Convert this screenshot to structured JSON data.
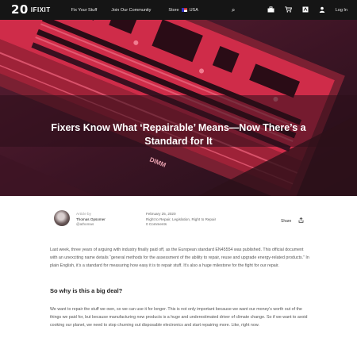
{
  "nav": {
    "logo_number": "20",
    "logo_word": "IFIXIT",
    "links": [
      "Fix Your Stuff",
      "Join Our Community"
    ],
    "store_label": "Store",
    "store_region": "USA",
    "login_label": "Log In",
    "icons": [
      "search-icon",
      "toolbox-icon",
      "cart-icon",
      "language-icon",
      "user-icon"
    ]
  },
  "hero": {
    "title": "Fixers Know What ‘Repairable’ Means—Now There’s a Standard for It",
    "board_label": "DIMM"
  },
  "article": {
    "author_prefix": "Article by",
    "author_name": "Thomas Opsomer",
    "author_handle": "@athomas",
    "date": "February 25, 2020",
    "tags": "Right to Repair, Legislation, Right to Repair",
    "comments": "0 Comments",
    "share_label": "Share",
    "paragraph1": "Last week, three years of arguing with industry finally paid off, as the European standard EN45554 was published. This official document with an unexciting name details “general methods for the assessment of the ability to repair, reuse and upgrade energy-related products.” In plain English, it’s a standard for measuring how easy it is to repair stuff. It’s also a huge milestone for the fight for our repair.",
    "heading": "So why is this a big deal?",
    "paragraph2": "We want to repair the stuff we own, so we can use it for longer. This is not only important because we want our money’s worth out of the things we paid for, but because manufacturing new products is a huge and underestimated driver of climate change. So if we want to avoid cooking our planet, we need to stop churning out disposable electronics and start repairing more. Like, right now."
  }
}
